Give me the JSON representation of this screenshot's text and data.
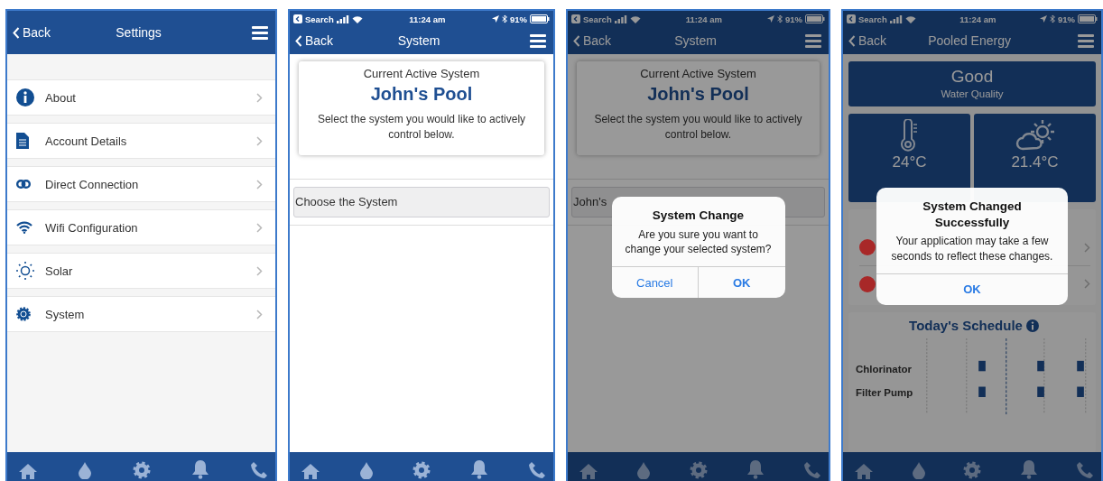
{
  "screens": [
    {
      "kind": "settings",
      "dimmed": false,
      "nav": {
        "back": "Back",
        "title": "Settings"
      },
      "items": [
        {
          "kind": "info",
          "label": "About"
        },
        {
          "kind": "document",
          "label": "Account Details"
        },
        {
          "kind": "link",
          "label": "Direct Connection"
        },
        {
          "kind": "wifi",
          "label": "Wifi Configuration"
        },
        {
          "kind": "sun",
          "label": "Solar"
        },
        {
          "kind": "gear",
          "label": "System"
        }
      ]
    },
    {
      "kind": "system",
      "dimmed": false,
      "status_bar": {
        "carrier": "Search",
        "time": "11:24 am",
        "battery": "91%"
      },
      "nav": {
        "back": "Back",
        "title": "System"
      },
      "card": {
        "caption": "Current Active System",
        "name": "John's Pool",
        "instructions": "Select the system you would like to actively control below."
      },
      "picker": {
        "label": "Choose the System"
      }
    },
    {
      "kind": "system",
      "dimmed": true,
      "status_bar": {
        "carrier": "Search",
        "time": "11:24 am",
        "battery": "91%"
      },
      "nav": {
        "back": "Back",
        "title": "System"
      },
      "card": {
        "caption": "Current Active System",
        "name": "John's Pool",
        "instructions": "Select the system you would like to actively control below."
      },
      "picker": {
        "label": "John's"
      },
      "alert": {
        "title": "System Change",
        "message": "Are you sure you want to change your selected system?",
        "buttons": [
          {
            "label": "Cancel",
            "kind": "cancel"
          },
          {
            "label": "OK",
            "kind": "default"
          }
        ]
      }
    },
    {
      "kind": "dashboard",
      "dimmed": true,
      "status_bar": {
        "carrier": "Search",
        "time": "11:24 am",
        "battery": "91%"
      },
      "nav": {
        "back": "Back",
        "title": "Pooled Energy"
      },
      "quality": {
        "value": "Good",
        "label": "Water Quality"
      },
      "tiles": [
        {
          "kind": "thermometer",
          "value": "24°C"
        },
        {
          "kind": "weather",
          "value": "21.4°C"
        }
      ],
      "equipment": [
        {
          "color": "#a82828"
        },
        {
          "color": "#a82828"
        }
      ],
      "schedule": {
        "title": "Today's Schedule",
        "rows": [
          "Chlorinator",
          "Filter Pump"
        ]
      },
      "alert": {
        "title": "System Changed Successfully",
        "message": "Your application may take a few seconds to reflect these changes.",
        "buttons": [
          {
            "label": "OK",
            "kind": "default"
          }
        ]
      }
    }
  ]
}
